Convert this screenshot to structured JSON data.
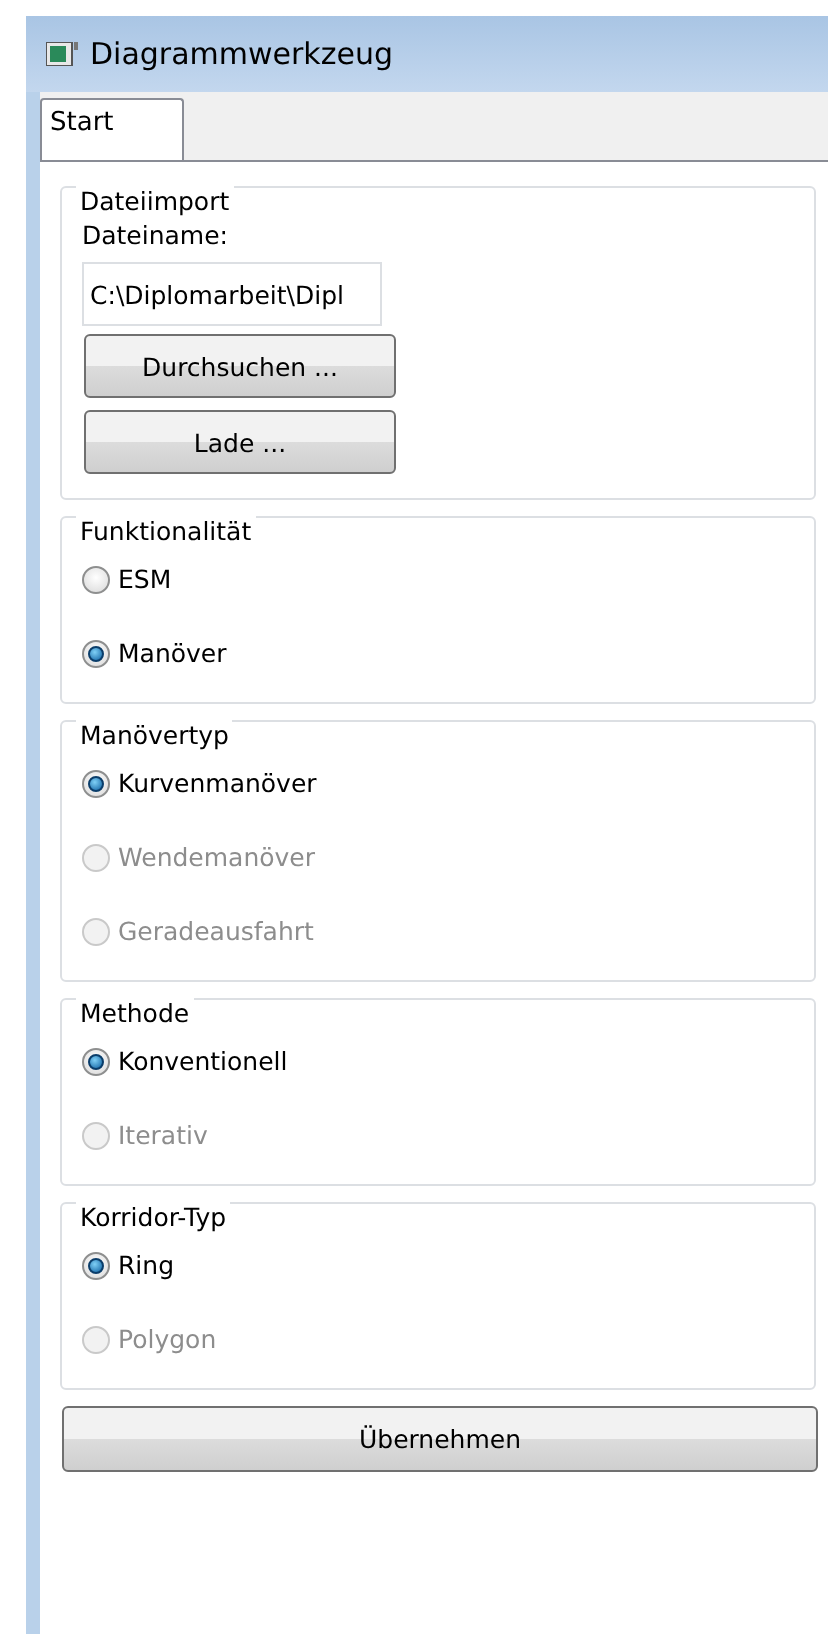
{
  "window": {
    "title": "Diagrammwerkzeug"
  },
  "tabs": [
    {
      "label": "Start",
      "selected": true
    }
  ],
  "file_import": {
    "title": "Dateiimport",
    "label": "Dateiname:",
    "value": "C:\\Diplomarbeit\\Dipl",
    "buttons": [
      "Durchsuchen ...",
      "Lade ..."
    ]
  },
  "groups": [
    {
      "title": "Funktionalität",
      "options": [
        {
          "label": "ESM",
          "selected": false,
          "disabled": false
        },
        {
          "label": "Manöver",
          "selected": true,
          "disabled": false
        }
      ]
    },
    {
      "title": "Manövertyp",
      "options": [
        {
          "label": "Kurvenmanöver",
          "selected": true,
          "disabled": false
        },
        {
          "label": "Wendemanöver",
          "selected": false,
          "disabled": true
        },
        {
          "label": "Geradeausfahrt",
          "selected": false,
          "disabled": true
        }
      ]
    },
    {
      "title": "Methode",
      "options": [
        {
          "label": "Konventionell",
          "selected": true,
          "disabled": false
        },
        {
          "label": "Iterativ",
          "selected": false,
          "disabled": true
        }
      ]
    },
    {
      "title": "Korridor-Typ",
      "options": [
        {
          "label": "Ring",
          "selected": true,
          "disabled": false
        },
        {
          "label": "Polygon",
          "selected": false,
          "disabled": true
        }
      ]
    }
  ],
  "apply_button": "Übernehmen"
}
